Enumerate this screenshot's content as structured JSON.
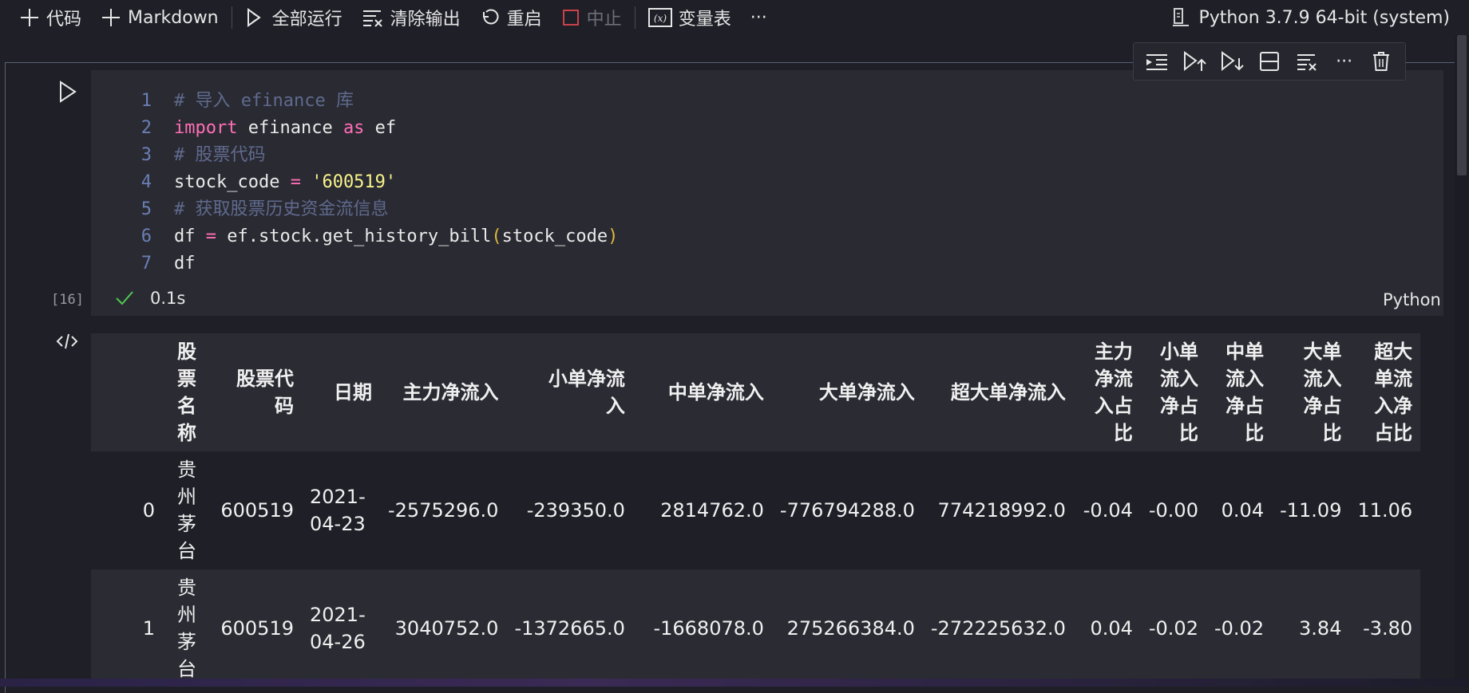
{
  "toolbar": {
    "add_code": "代码",
    "add_markdown": "Markdown",
    "run_all": "全部运行",
    "clear_outputs": "清除输出",
    "restart": "重启",
    "interrupt": "中止",
    "variables": "变量表",
    "more": "···"
  },
  "kernel": {
    "label": "Python 3.7.9 64-bit (system)"
  },
  "cell": {
    "lines": [
      {
        "n": "1",
        "tokens": [
          {
            "t": "comment",
            "v": "# 导入 efinance 库"
          }
        ]
      },
      {
        "n": "2",
        "tokens": [
          {
            "t": "kw",
            "v": "import"
          },
          {
            "t": "plain",
            "v": " efinance "
          },
          {
            "t": "kw",
            "v": "as"
          },
          {
            "t": "plain",
            "v": " ef"
          }
        ]
      },
      {
        "n": "3",
        "tokens": [
          {
            "t": "comment",
            "v": "# 股票代码"
          }
        ]
      },
      {
        "n": "4",
        "tokens": [
          {
            "t": "plain",
            "v": "stock_code "
          },
          {
            "t": "op",
            "v": "="
          },
          {
            "t": "plain",
            "v": " "
          },
          {
            "t": "str",
            "v": "'600519'"
          }
        ]
      },
      {
        "n": "5",
        "tokens": [
          {
            "t": "comment",
            "v": "# 获取股票历史资金流信息"
          }
        ]
      },
      {
        "n": "6",
        "tokens": [
          {
            "t": "plain",
            "v": "df "
          },
          {
            "t": "op",
            "v": "="
          },
          {
            "t": "plain",
            "v": " ef.stock.get_history_bill"
          },
          {
            "t": "paren",
            "v": "("
          },
          {
            "t": "plain",
            "v": "stock_code"
          },
          {
            "t": "paren",
            "v": ")"
          }
        ]
      },
      {
        "n": "7",
        "tokens": [
          {
            "t": "plain",
            "v": "df"
          }
        ]
      }
    ],
    "exec_count": "[16]",
    "duration": "0.1s",
    "language": "Python"
  },
  "table": {
    "headers": [
      "",
      "股\n票\n名\n称",
      "股票代\n码",
      "日期",
      "主力净流入",
      "小单净流\n入",
      "中单净流入",
      "大单净流入",
      "超大单净流入",
      "主力\n净流\n入占\n比",
      "小单\n流入\n净占\n比",
      "中单\n流入\n净占\n比",
      "大单\n流入\n净占\n比",
      "超大\n单流\n入净\n占比"
    ],
    "rows": [
      [
        "0",
        "贵\n州\n茅\n台",
        "600519",
        "2021-\n04-23",
        "-2575296.0",
        "-239350.0",
        "2814762.0",
        "-776794288.0",
        "774218992.0",
        "-0.04",
        "-0.00",
        "0.04",
        "-11.09",
        "11.06"
      ],
      [
        "1",
        "贵\n州\n茅\n台",
        "600519",
        "2021-\n04-26",
        "3040752.0",
        "-1372665.0",
        "-1668078.0",
        "275266384.0",
        "-272225632.0",
        "0.04",
        "-0.02",
        "-0.02",
        "3.84",
        "-3.80"
      ]
    ]
  },
  "colors": {
    "background": "#1f1f28",
    "cell_background": "#2a2a33",
    "keyword": "#ff6fb5",
    "string": "#f7f38a",
    "comment": "#5f6a8c",
    "line_number": "#6a7fb3",
    "success": "#4ec94e"
  }
}
